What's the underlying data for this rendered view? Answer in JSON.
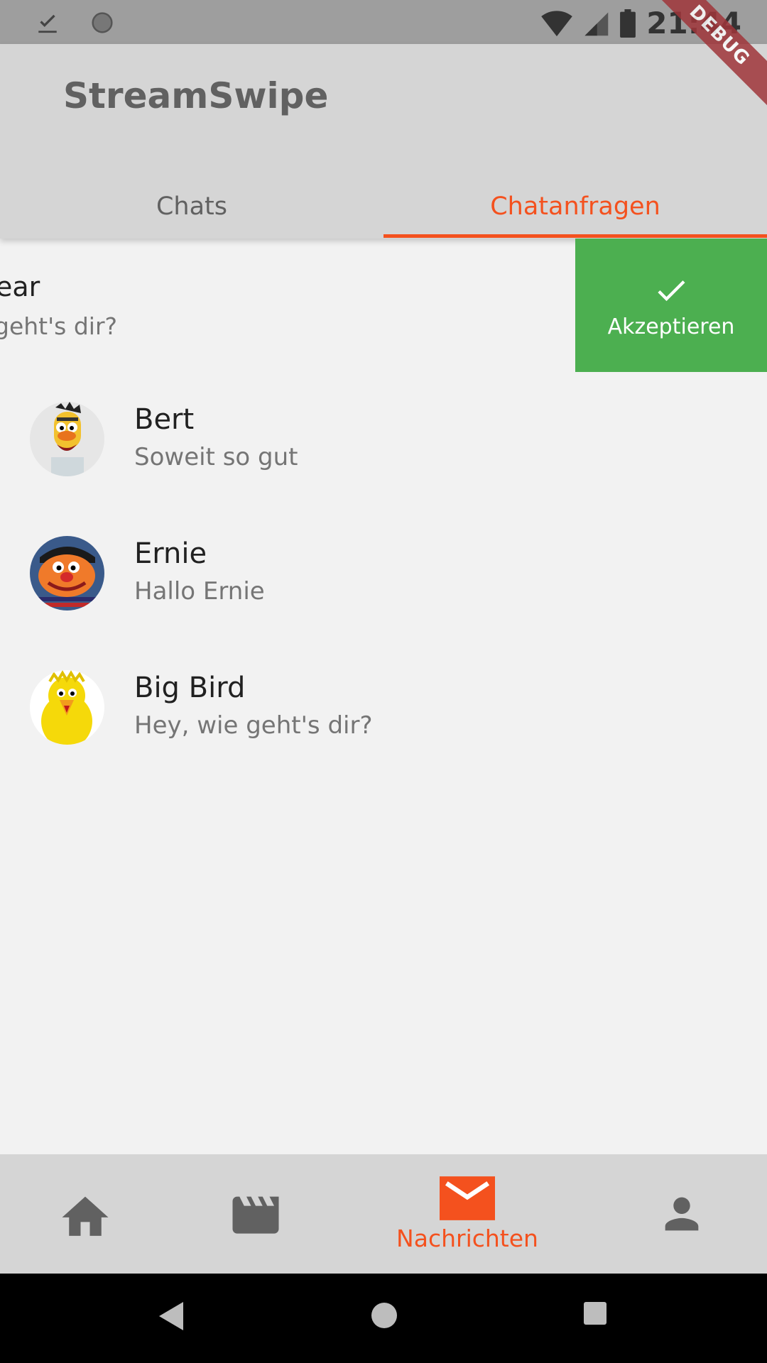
{
  "status_bar": {
    "time": "21:44",
    "icons": [
      "download-done-icon",
      "sync-icon",
      "wifi-icon",
      "signal-icon",
      "battery-icon"
    ]
  },
  "debug_banner": "DEBUG",
  "app_bar": {
    "title": "StreamSwipe",
    "tabs": [
      {
        "label": "Chats",
        "active": false
      },
      {
        "label": "Chatanfragen",
        "active": true
      }
    ]
  },
  "swiped_request": {
    "name_partial": "ear",
    "message_partial": "geht's dir?",
    "action_label": "Akzeptieren",
    "action_icon": "check-icon",
    "action_color": "#4caf50"
  },
  "requests": [
    {
      "name": "Bert",
      "message": "Soweit so gut"
    },
    {
      "name": "Ernie",
      "message": "Hallo Ernie"
    },
    {
      "name": "Big Bird",
      "message": "Hey, wie geht's dir?"
    }
  ],
  "bottom_nav": {
    "items": [
      {
        "icon": "home-icon",
        "label": "",
        "active": false
      },
      {
        "icon": "movie-icon",
        "label": "",
        "active": false
      },
      {
        "icon": "mail-icon",
        "label": "Nachrichten",
        "active": true
      },
      {
        "icon": "person-icon",
        "label": "",
        "active": false
      }
    ]
  },
  "colors": {
    "accent": "#f4511e",
    "accept": "#4caf50",
    "app_bar": "#d5d5d5",
    "background": "#f2f2f2"
  }
}
